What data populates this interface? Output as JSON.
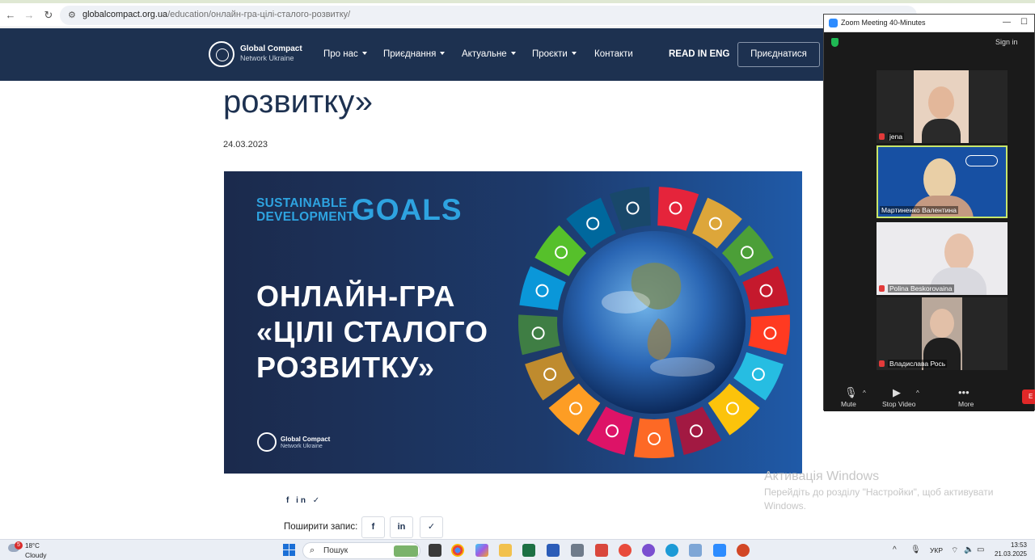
{
  "browser": {
    "url_domain": "globalcompact.org.ua",
    "url_path": "/education/онлайн-гра-цілі-сталого-розвитку/"
  },
  "site_nav": {
    "logo_line1": "Global Compact",
    "logo_line2": "Network Ukraine",
    "menu": [
      "Про нас",
      "Приєднання",
      "Актуальне",
      "Проєкти",
      "Контакти"
    ],
    "read_in_eng": "READ IN ENG",
    "join_button": "Приєднатися"
  },
  "article": {
    "title_fragment": "розвитку»",
    "date": "24.03.2023"
  },
  "banner": {
    "sdg_line1": "SUSTAINABLE",
    "sdg_line2": "DEVELOPMENT",
    "goals_word": "GOALS",
    "headline": [
      "ОНЛАЙН-ГРА",
      "«ЦІЛІ СТАЛОГО",
      "РОЗВИТКУ»"
    ],
    "logo_line1": "Global Compact",
    "logo_line2": "Network Ukraine",
    "sdg_colors": [
      "#e5243b",
      "#dda63a",
      "#4c9f38",
      "#c5192d",
      "#ff3a21",
      "#26bde2",
      "#fcc30b",
      "#a21942",
      "#fd6925",
      "#dd1367",
      "#fd9d24",
      "#bf8b2e",
      "#3f7e44",
      "#0a97d9",
      "#56c02b",
      "#00689d",
      "#19486a"
    ]
  },
  "share": {
    "mini_icons": "f in ✓",
    "label": "Поширити запис:",
    "buttons": [
      "f",
      "in",
      "✓"
    ]
  },
  "windows_activation": {
    "title": "Активація Windows",
    "line1": "Перейдіть до розділу \"Настройки\", щоб активувати",
    "line2": "Windows."
  },
  "zoom": {
    "title": "Zoom Meeting 40-Minutes",
    "sign_in": "Sign in",
    "participants": [
      "jena",
      "Мартиненко Валентина",
      "Polina Beskorovaina",
      "Владислава Рось"
    ],
    "controls": {
      "mute": "Mute",
      "stop_video": "Stop Video",
      "more": "More",
      "end": "E"
    }
  },
  "taskbar": {
    "weather_badge": "5",
    "temperature": "18°C",
    "condition": "Cloudy",
    "search_placeholder": "Пошук",
    "language": "УКР",
    "time": "13:53",
    "date": "21.03.2025"
  }
}
